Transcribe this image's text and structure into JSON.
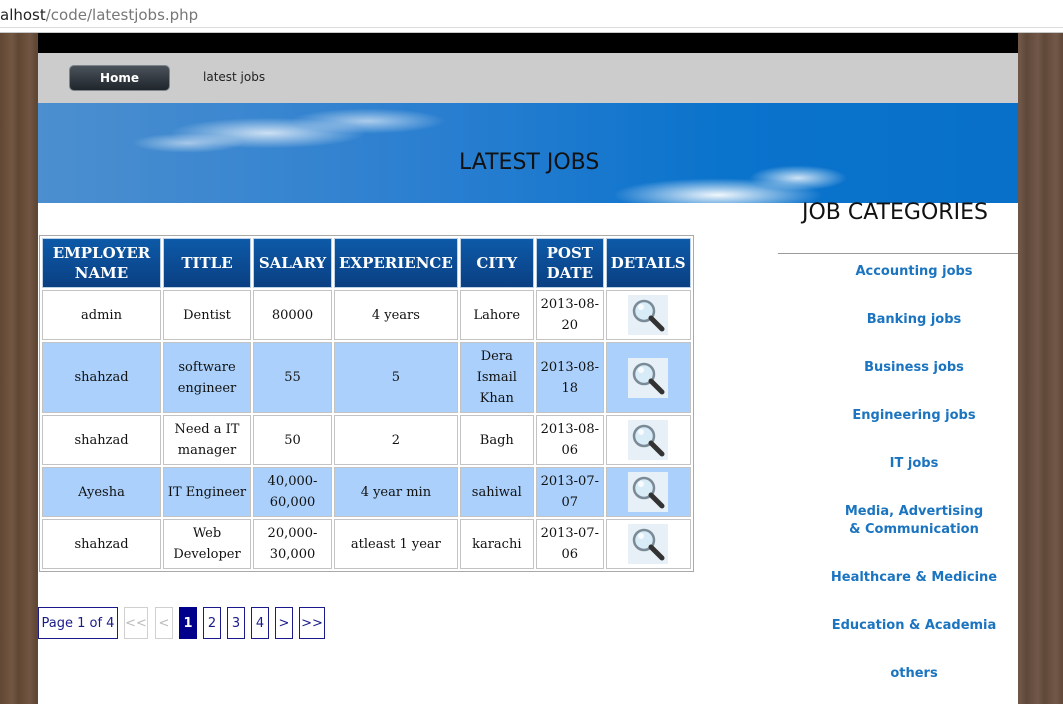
{
  "browser": {
    "url_host": "alhost",
    "url_path": "/code/latestjobs.php"
  },
  "nav": {
    "home_label": "Home",
    "latest_label": "latest jobs"
  },
  "banner": {
    "title": "LATEST JOBS"
  },
  "table": {
    "headers": [
      "EMPLOYER NAME",
      "TITLE",
      "SALARY",
      "EXPERIENCE",
      "CITY",
      "POST DATE",
      "DETAILS"
    ],
    "rows": [
      {
        "employer": "admin",
        "title": "Dentist",
        "salary": "80000",
        "experience": "4 years",
        "city": "Lahore",
        "post_date": "2013-08-20"
      },
      {
        "employer": "shahzad",
        "title": "software engineer",
        "salary": "55",
        "experience": "5",
        "city": "Dera Ismail Khan",
        "post_date": "2013-08-18"
      },
      {
        "employer": "shahzad",
        "title": "Need a IT manager",
        "salary": "50",
        "experience": "2",
        "city": "Bagh",
        "post_date": "2013-08-06"
      },
      {
        "employer": "Ayesha",
        "title": "IT Engineer",
        "salary": "40,000-60,000",
        "experience": "4 year min",
        "city": "sahiwal",
        "post_date": "2013-07-07"
      },
      {
        "employer": "shahzad",
        "title": "Web Developer",
        "salary": "20,000-30,000",
        "experience": "atleast 1 year",
        "city": "karachi",
        "post_date": "2013-07-06"
      }
    ],
    "details_icon": "magnifier-icon"
  },
  "pager": {
    "summary": "Page 1 of 4",
    "first": "<<",
    "prev": "<",
    "pages": [
      "1",
      "2",
      "3",
      "4"
    ],
    "current": "1",
    "next": ">",
    "last": ">>"
  },
  "sidebar": {
    "title": "JOB CATEGORIES",
    "categories": [
      "Accounting jobs",
      "Banking jobs",
      "Business jobs",
      "Engineering jobs",
      "IT jobs",
      "Media, Advertising & Communication",
      "Healthcare & Medicine",
      "Education & Academia",
      "others"
    ]
  },
  "colors": {
    "header_bg": "#0a4a92",
    "row_alt": "#aad0fb",
    "link": "#1b74c0",
    "pager_active": "#00008b"
  }
}
